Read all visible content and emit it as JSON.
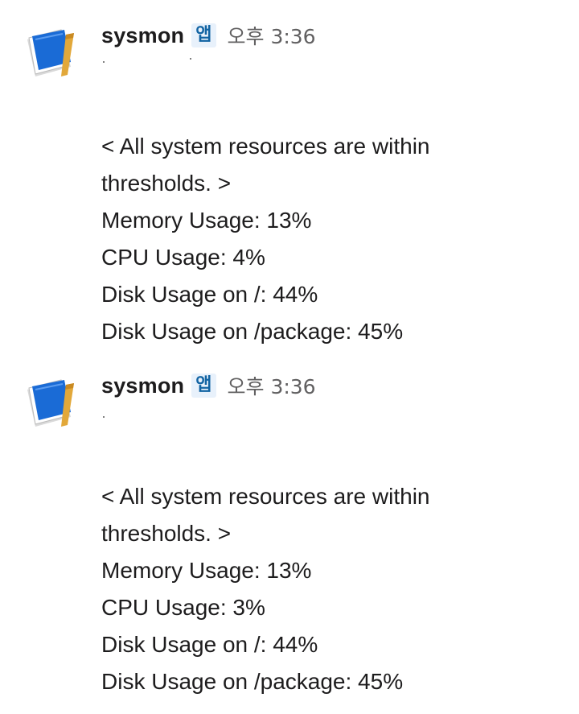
{
  "messages": [
    {
      "sender": "sysmon",
      "badge": "앱",
      "timestamp": "오후 3:36",
      "lines": [
        "< All system resources are within",
        "thresholds. >",
        "Memory Usage: 13%",
        "CPU Usage: 4%",
        "Disk Usage on /: 44%",
        "Disk Usage on /package: 45%"
      ]
    },
    {
      "sender": "sysmon",
      "badge": "앱",
      "timestamp": "오후 3:36",
      "lines": [
        "< All system resources are within",
        "thresholds. >",
        "Memory Usage: 13%",
        "CPU Usage: 3%",
        "Disk Usage on /: 44%",
        "Disk Usage on /package: 45%"
      ]
    }
  ],
  "avatar_icon": "notebook-icon",
  "colors": {
    "badge_bg": "#e8f1fb",
    "badge_text": "#1264a3",
    "timestamp": "#616061",
    "text": "#1d1c1d",
    "avatar_blue": "#1a6bd6",
    "avatar_ribbon": "#e2a83a"
  }
}
